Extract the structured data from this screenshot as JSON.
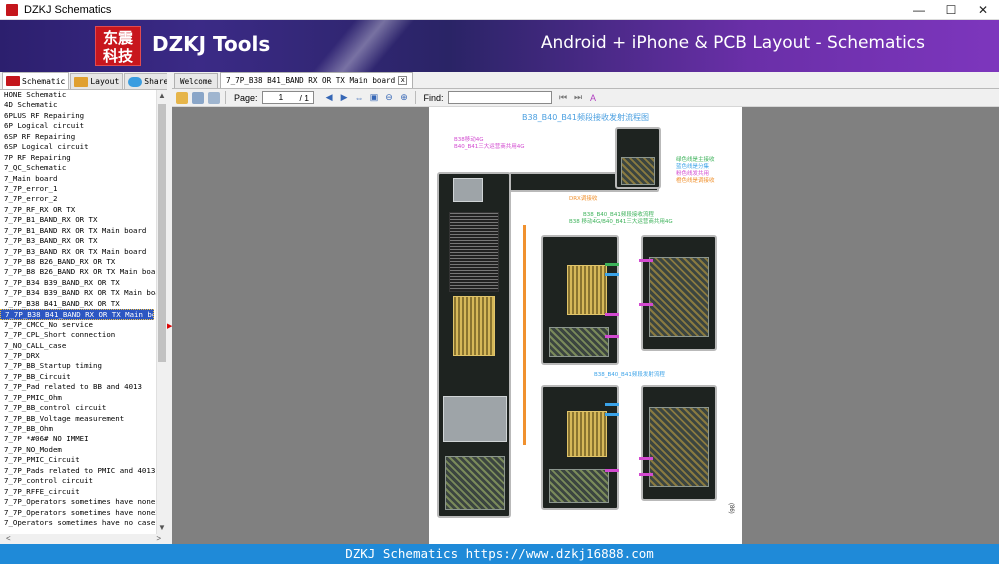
{
  "window": {
    "title": "DZKJ Schematics",
    "controls": [
      "—",
      "☐",
      "✕"
    ]
  },
  "banner": {
    "logo_line1": "东震",
    "logo_line2": "科技",
    "brand": "DZKJ Tools",
    "slogan": "Android + iPhone & PCB Layout - Schematics"
  },
  "left_tabs": [
    {
      "label": "Schematic",
      "icon": "schematic-icon",
      "color": "#c4161c"
    },
    {
      "label": "Layout",
      "icon": "pads-icon",
      "color": "#e0a030"
    },
    {
      "label": "Share",
      "icon": "share-icon",
      "color": "#3a9de0"
    }
  ],
  "tree": {
    "items": [
      "HONE Schematic",
      "4D Schematic",
      "6PLUS RF Repairing",
      "6P Logical circuit",
      "6SP RF Repairing",
      "6SP Logical circuit",
      "7P RF Repairing",
      "7_QC_Schematic",
      "7_Main board",
      "7_7P_error_1",
      "7_7P_error_2",
      "7_7P_RF_RX OR TX",
      "7_7P_B1_BAND_RX OR TX",
      "7_7P_B1_BAND RX OR TX Main board",
      "7_7P_B3_BAND_RX OR TX",
      "7_7P_B3_BAND RX OR TX Main board",
      "7_7P_B8 B26_BAND_RX OR TX",
      "7_7P_B8 B26_BAND RX OR TX Main board",
      "7_7P_B34 B39_BAND_RX OR TX",
      "7_7P_B34 B39_BAND RX OR TX Main board",
      "7_7P_B38 B41_BAND_RX OR TX",
      "7_7P_B38 B41_BAND RX OR TX Main board",
      "7_7P_CMCC_No service",
      "7_7P_CPL_Short connection",
      "7_NO_CALL_case",
      "7_7P_DRX",
      "7_7P_BB_Startup timing",
      "7_7P_BB_Circuit",
      "7_7P_Pad related to BB and 4013",
      "7_7P_PMIC_Ohm",
      "7_7P_BB_control circuit",
      "7_7P_BB_Voltage measurement",
      "7_7P_BB_Ohm",
      "7_7P *#06# NO IMMEI",
      "7_7P_NO_Modem",
      "7_7P_PMIC_Circuit",
      "7_7P_Pads related to PMIC and 4013",
      "7_7P_control circuit",
      "7_7P_RFFE_circuit",
      "7_7P_Operators sometimes have none1",
      "7_7P_Operators sometimes have none2",
      "7_Operators sometimes have no case"
    ],
    "selected_index": 21
  },
  "doc_tabs": [
    {
      "label": "Welcome"
    },
    {
      "label": "7_7P_B38 B41_BAND RX OR TX Main board",
      "active": true,
      "close": "x"
    }
  ],
  "toolbar": {
    "page_label": "Page:",
    "page_value": "1",
    "page_total": "/ 1",
    "find_label": "Find:",
    "find_value": ""
  },
  "document": {
    "title": "B38_B40_B41频段接收发射流程图",
    "note_top_line1": "B38移动4G",
    "note_top_line2": "B40_B41三大运营商共用4G",
    "legend": [
      {
        "text": "绿色线是主接收",
        "color": "#3db25a"
      },
      {
        "text": "蓝色线是分集",
        "color": "#3aa2e8"
      },
      {
        "text": "粉色线发共用",
        "color": "#d24ad0"
      },
      {
        "text": "橙色线是调接收",
        "color": "#f0912e"
      }
    ],
    "label_mid": "DRX调接收",
    "rx_title_line1": "B38_B40_B41频段接收流程",
    "rx_title_line2": "B38 移动4G/B40_B41三大运营商共用4G",
    "tx_title": "B38_B40_B41频段发射流程",
    "page_number": "(86)"
  },
  "status_bar": {
    "text": "DZKJ Schematics https://www.dzkj16888.com"
  }
}
